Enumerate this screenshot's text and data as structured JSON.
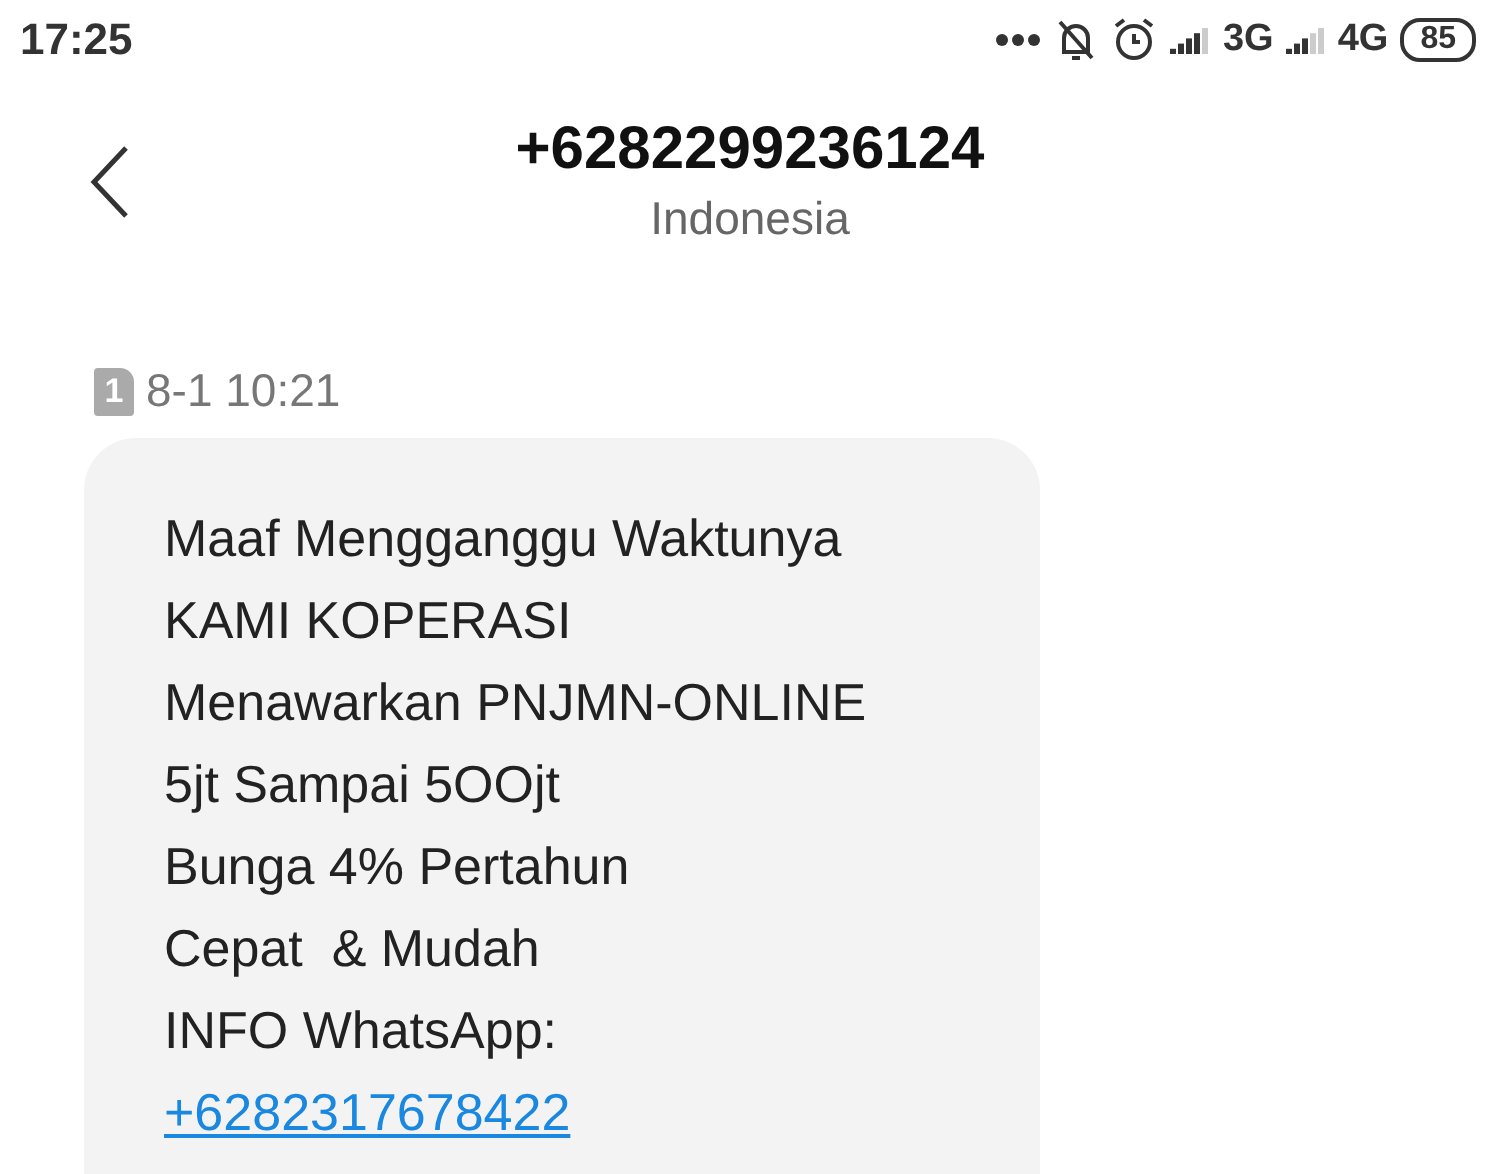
{
  "status_bar": {
    "time": "17:25",
    "network_1": "3G",
    "network_2": "4G",
    "battery": "85"
  },
  "header": {
    "title": "+6282299236124",
    "subtitle": "Indonesia"
  },
  "message": {
    "sim": "1",
    "timestamp": "8-1 10:21",
    "lines": [
      "Maaf Mengganggu Waktunya",
      "KAMI KOPERASI",
      "Menawarkan PNJMN-ONLINE",
      "5jt Sampai 5OOjt",
      "Bunga 4% Pertahun",
      "Cepat  & Mudah",
      "INFO WhatsApp:"
    ],
    "link": "+6282317678422"
  }
}
